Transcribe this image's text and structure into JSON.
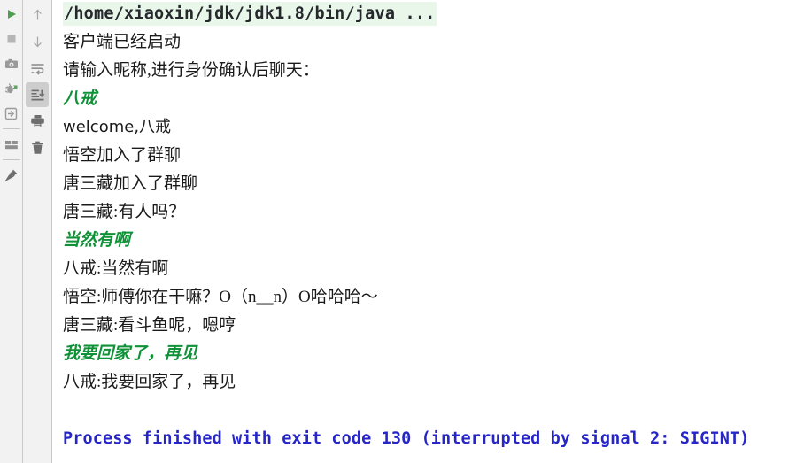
{
  "window": {
    "title": "Run console",
    "background": "#ffffff",
    "toolbar_background": "#f2f2f2"
  },
  "colors": {
    "command_highlight": "#e9f7ea",
    "user_input_green": "#0f9137",
    "exit_message_blue": "#2626c8",
    "body_text": "#1a1a1a",
    "run_icon_green": "#4f9e4f"
  },
  "toolbar_left": {
    "name": "run-actions-toolbar",
    "items": [
      {
        "name": "rerun-button",
        "icon": "play-icon",
        "tooltip": "Rerun"
      },
      {
        "name": "stop-button",
        "icon": "stop-square-icon",
        "tooltip": "Stop"
      },
      {
        "name": "thread-dump-button",
        "icon": "camera-icon",
        "tooltip": "Dump Threads"
      },
      {
        "name": "restart-debugger-button",
        "icon": "bug-restart-icon",
        "tooltip": "Restart"
      },
      {
        "name": "attach-process-button",
        "icon": "attach-arrow-into-box-icon",
        "tooltip": "Attach"
      },
      {
        "name": "layout-settings-button",
        "icon": "layout-split-icon",
        "tooltip": "Layout Settings"
      },
      {
        "name": "pin-tab-button",
        "icon": "pin-icon",
        "tooltip": "Pin Tab"
      }
    ]
  },
  "toolbar_right": {
    "name": "console-view-toolbar",
    "items": [
      {
        "name": "previous-occurrence-button",
        "icon": "arrow-up-icon",
        "tooltip": "Up the Stack Trace",
        "active": false
      },
      {
        "name": "next-occurrence-button",
        "icon": "arrow-down-icon",
        "tooltip": "Down the Stack Trace",
        "active": false
      },
      {
        "name": "soft-wrap-button",
        "icon": "soft-wrap-icon",
        "tooltip": "Soft-Wrap",
        "active": false
      },
      {
        "name": "scroll-to-end-button",
        "icon": "scroll-to-end-icon",
        "tooltip": "Scroll to the end",
        "active": true
      },
      {
        "name": "print-button",
        "icon": "printer-icon",
        "tooltip": "Print",
        "active": false
      },
      {
        "name": "clear-all-button",
        "icon": "trash-icon",
        "tooltip": "Clear All",
        "active": false
      }
    ]
  },
  "console": {
    "name": "run-console-output",
    "lines": [
      {
        "text": "/home/xiaoxin/jdk/jdk1.8/bin/java ...",
        "kind": "command"
      },
      {
        "text": "客户端已经启动",
        "kind": "output"
      },
      {
        "text": "请输入昵称,进行身份确认后聊天：",
        "kind": "output"
      },
      {
        "text": "八戒",
        "kind": "user-input"
      },
      {
        "text": "welcome,八戒",
        "kind": "output-mono"
      },
      {
        "text": "悟空加入了群聊",
        "kind": "output"
      },
      {
        "text": "唐三藏加入了群聊",
        "kind": "output"
      },
      {
        "text": "唐三藏:有人吗？",
        "kind": "output"
      },
      {
        "text": "当然有啊",
        "kind": "user-input"
      },
      {
        "text": "八戒:当然有啊",
        "kind": "output"
      },
      {
        "text": "悟空:师傅你在干嘛？O（n__n）O哈哈哈～",
        "kind": "output"
      },
      {
        "text": "唐三藏:看斗鱼呢，嗯哼",
        "kind": "output"
      },
      {
        "text": "我要回家了，再见",
        "kind": "user-input"
      },
      {
        "text": "八戒:我要回家了，再见",
        "kind": "output"
      },
      {
        "text": "",
        "kind": "blank"
      },
      {
        "text": "Process finished with exit code 130 (interrupted by signal 2: SIGINT)",
        "kind": "exit"
      }
    ]
  }
}
